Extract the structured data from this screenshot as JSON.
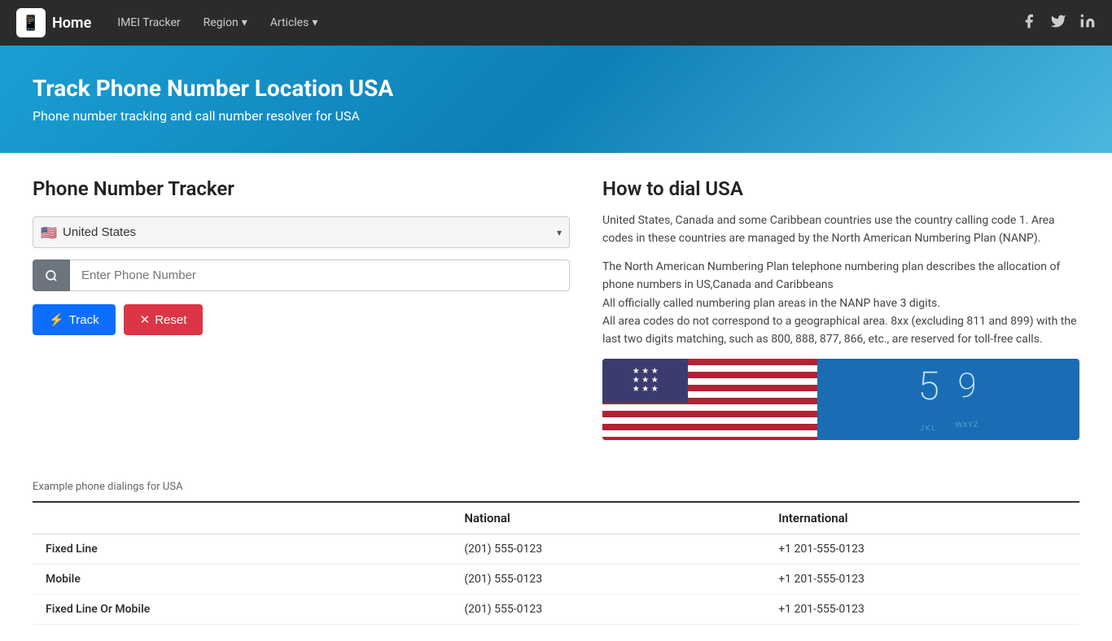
{
  "nav": {
    "brand_label": "Home",
    "links": [
      {
        "label": "IMEI Tracker",
        "has_dropdown": false
      },
      {
        "label": "Region",
        "has_dropdown": true
      },
      {
        "label": "Articles",
        "has_dropdown": true
      }
    ],
    "social": [
      {
        "name": "facebook",
        "icon": "f"
      },
      {
        "name": "twitter",
        "icon": "t"
      },
      {
        "name": "linkedin",
        "icon": "in"
      }
    ]
  },
  "hero": {
    "title": "Track Phone Number Location USA",
    "subtitle": "Phone number tracking and call number resolver for USA"
  },
  "tracker": {
    "title": "Phone Number Tracker",
    "country": "United States",
    "country_flag": "🇺🇸",
    "phone_placeholder": "Enter Phone Number",
    "track_label": "Track",
    "reset_label": "Reset"
  },
  "how_to_dial": {
    "title": "How to dial USA",
    "paragraphs": [
      "United States, Canada and some Caribbean countries use the country calling code 1. Area codes in these countries are managed by the North American Numbering Plan (NANP).",
      "The North American Numbering Plan telephone numbering plan describes the allocation of phone numbers in US,Canada and Caribbeans\nAll officially called numbering plan areas in the NANP have 3 digits.\nAll area codes do not correspond to a geographical area. 8xx (excluding 811 and 899) with the last two digits matching, such as 800, 888, 877, 866, etc., are reserved for toll-free calls."
    ]
  },
  "example_table": {
    "label": "Example phone dialings for USA",
    "headers": [
      "",
      "National",
      "International"
    ],
    "rows": [
      {
        "type": "Fixed Line",
        "national": "(201)  555-0123",
        "international": "+1  201-555-0123"
      },
      {
        "type": "Mobile",
        "national": "(201)  555-0123",
        "international": "+1  201-555-0123"
      },
      {
        "type": "Fixed Line Or Mobile",
        "national": "(201)  555-0123",
        "international": "+1  201-555-0123"
      }
    ]
  }
}
